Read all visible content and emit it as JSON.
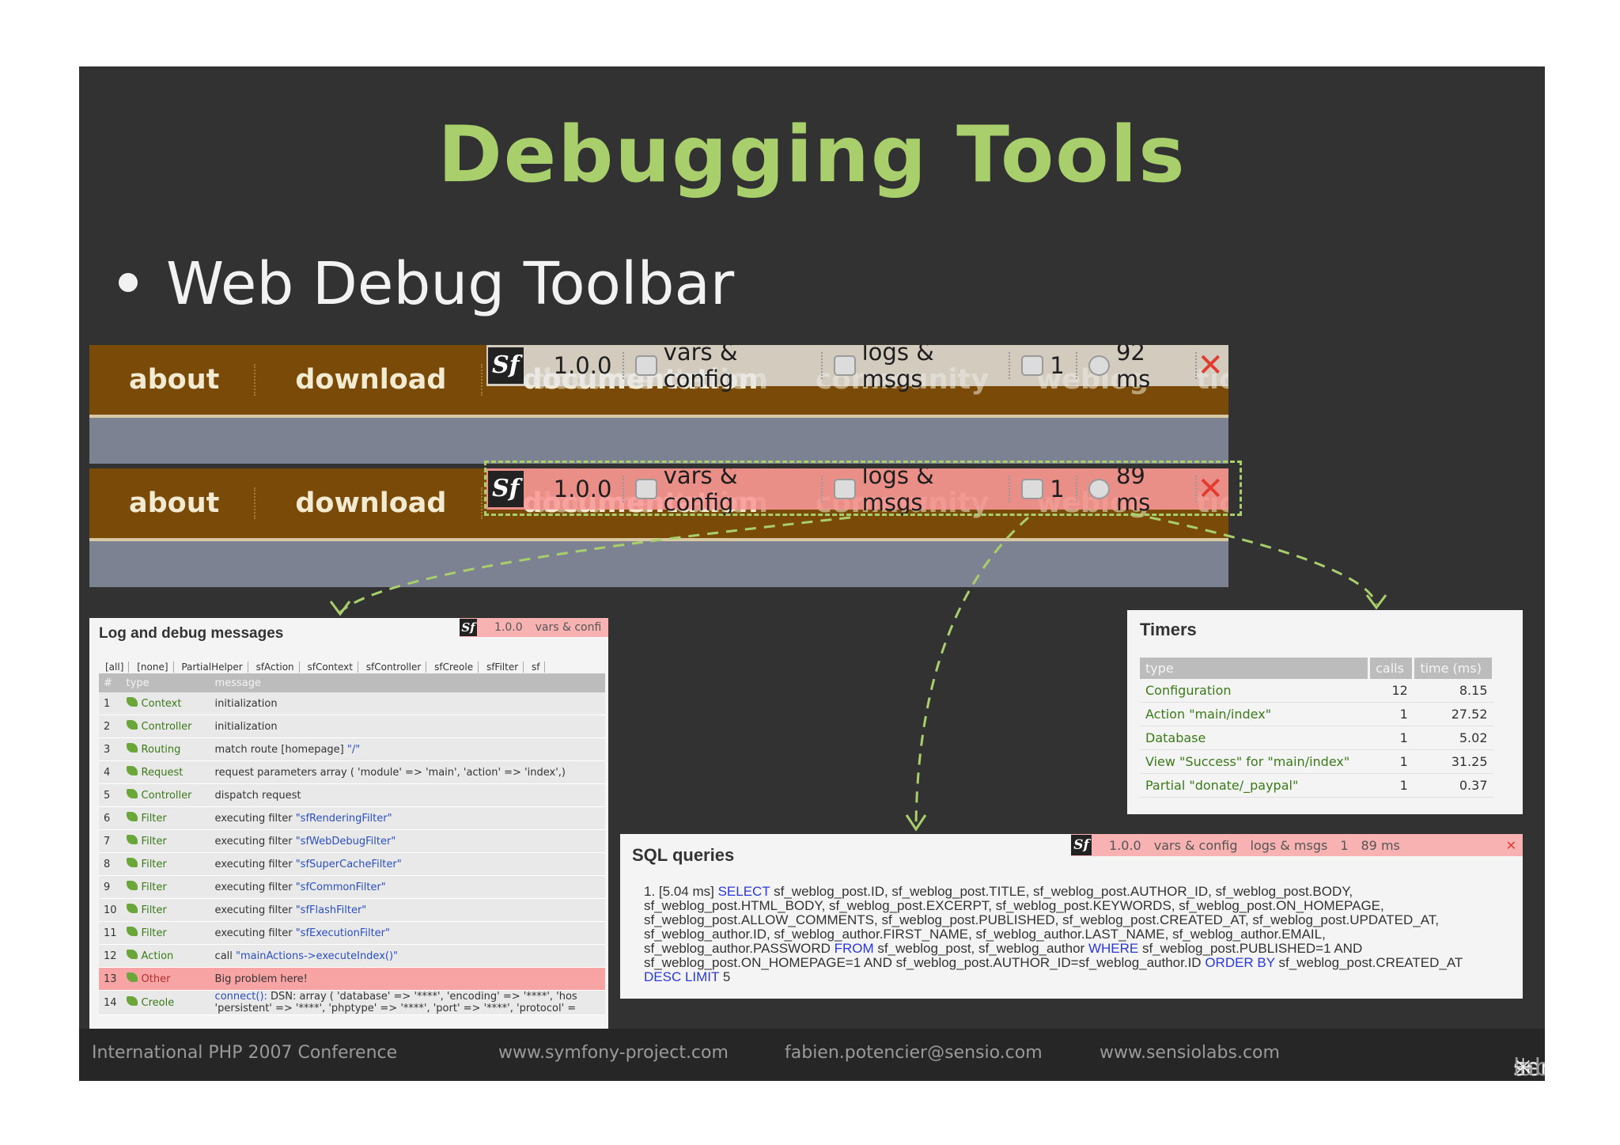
{
  "slide": {
    "title": "Debugging Tools",
    "bullet": "Web Debug Toolbar"
  },
  "site_nav": {
    "items": [
      "about",
      "download",
      "documentation"
    ],
    "ghost_items": [
      "documentation",
      "community",
      "weblog",
      "tickets"
    ]
  },
  "toolbar_top": {
    "logo": "Sf",
    "version": "1.0.0",
    "vars": "vars & config",
    "logs": "logs & msgs",
    "db": "1",
    "time": "92 ms",
    "close": "✕"
  },
  "toolbar_bottom": {
    "logo": "Sf",
    "version": "1.0.0",
    "vars": "vars & config",
    "logs": "logs & msgs",
    "db": "1",
    "time": "89 ms",
    "close": "✕"
  },
  "log_panel": {
    "title": "Log and debug messages",
    "mini_toolbar": [
      "Sf",
      "1.0.0",
      "vars & confi"
    ],
    "filters": [
      "[all]",
      "[none]",
      "PartialHelper",
      "sfAction",
      "sfContext",
      "sfController",
      "sfCreole",
      "sfFilter",
      "sf"
    ],
    "columns": [
      "#",
      "type",
      "message"
    ],
    "rows": [
      {
        "n": "1",
        "type": "Context",
        "msg": "initialization",
        "hl": ""
      },
      {
        "n": "2",
        "type": "Controller",
        "msg": "initialization",
        "hl": ""
      },
      {
        "n": "3",
        "type": "Routing",
        "msg": "match route [homepage] ",
        "hl": "\"/\""
      },
      {
        "n": "4",
        "type": "Request",
        "msg": "request parameters array ( 'module' => 'main', 'action' => 'index',)",
        "hl": ""
      },
      {
        "n": "5",
        "type": "Controller",
        "msg": "dispatch request",
        "hl": ""
      },
      {
        "n": "6",
        "type": "Filter",
        "msg": "executing filter ",
        "hl": "\"sfRenderingFilter\""
      },
      {
        "n": "7",
        "type": "Filter",
        "msg": "executing filter ",
        "hl": "\"sfWebDebugFilter\""
      },
      {
        "n": "8",
        "type": "Filter",
        "msg": "executing filter ",
        "hl": "\"sfSuperCacheFilter\""
      },
      {
        "n": "9",
        "type": "Filter",
        "msg": "executing filter ",
        "hl": "\"sfCommonFilter\""
      },
      {
        "n": "10",
        "type": "Filter",
        "msg": "executing filter ",
        "hl": "\"sfFlashFilter\""
      },
      {
        "n": "11",
        "type": "Filter",
        "msg": "executing filter ",
        "hl": "\"sfExecutionFilter\""
      },
      {
        "n": "12",
        "type": "Action",
        "msg": "call ",
        "hl": "\"mainActions->executeIndex()\""
      },
      {
        "n": "13",
        "type": "Other",
        "msg": "Big problem here!",
        "hl": ""
      },
      {
        "n": "14",
        "type": "Creole",
        "msg": "DSN: array ( 'database' => '****', 'encoding' => '****', 'hos 'persistent' => '****', 'phptype' => '****', 'port' => '****', 'protocol' =",
        "hl": "connect():"
      }
    ]
  },
  "timers_panel": {
    "title": "Timers",
    "columns": [
      "type",
      "calls",
      "time (ms)"
    ],
    "rows": [
      {
        "type": "Configuration",
        "calls": "12",
        "time": "8.15"
      },
      {
        "type": "Action \"main/index\"",
        "calls": "1",
        "time": "27.52"
      },
      {
        "type": "Database",
        "calls": "1",
        "time": "5.02"
      },
      {
        "type": "View \"Success\" for \"main/index\"",
        "calls": "1",
        "time": "31.25"
      },
      {
        "type": "Partial \"donate/_paypal\"",
        "calls": "1",
        "time": "0.37"
      }
    ]
  },
  "sql_panel": {
    "title": "SQL queries",
    "mini_toolbar": [
      "Sf",
      "1.0.0",
      "vars & config",
      "logs & msgs",
      "1",
      "89 ms"
    ],
    "query_number": "1.",
    "query_time": "[5.04 ms]",
    "kw_select": "SELECT",
    "part1": " sf_weblog_post.ID, sf_weblog_post.TITLE, sf_weblog_post.AUTHOR_ID, sf_weblog_post.BODY, sf_weblog_post.HTML_BODY, sf_weblog_post.EXCERPT, sf_weblog_post.KEYWORDS, sf_weblog_post.ON_HOMEPAGE, sf_weblog_post.ALLOW_COMMENTS, sf_weblog_post.PUBLISHED, sf_weblog_post.CREATED_AT, sf_weblog_post.UPDATED_AT, sf_weblog_author.ID, sf_weblog_author.FIRST_NAME, sf_weblog_author.LAST_NAME, sf_weblog_author.EMAIL, sf_weblog_author.PASSWORD ",
    "kw_from": "FROM",
    "part2": " sf_weblog_post, sf_weblog_author ",
    "kw_where": "WHERE",
    "part3": " sf_weblog_post.PUBLISHED=1 AND sf_weblog_post.ON_HOMEPAGE=1 AND sf_weblog_post.AUTHOR_ID=sf_weblog_author.ID ",
    "kw_order": "ORDER BY",
    "part4": " sf_weblog_post.CREATED_AT ",
    "kw_desc": "DESC LIMIT",
    "part5": " 5"
  },
  "footer": {
    "conference": "International PHP 2007 Conference",
    "site": "www.symfony-project.com",
    "email": "fabien.potencier@sensio.com",
    "company_site": "www.sensiolabs.com",
    "brand_main": "sensio",
    "brand_sub": "labs"
  },
  "colors": {
    "title": "#a8cf6b",
    "nav_band": "#7a4a08",
    "toolbar_alert": "#f89898",
    "callout": "#a8cf6b"
  }
}
